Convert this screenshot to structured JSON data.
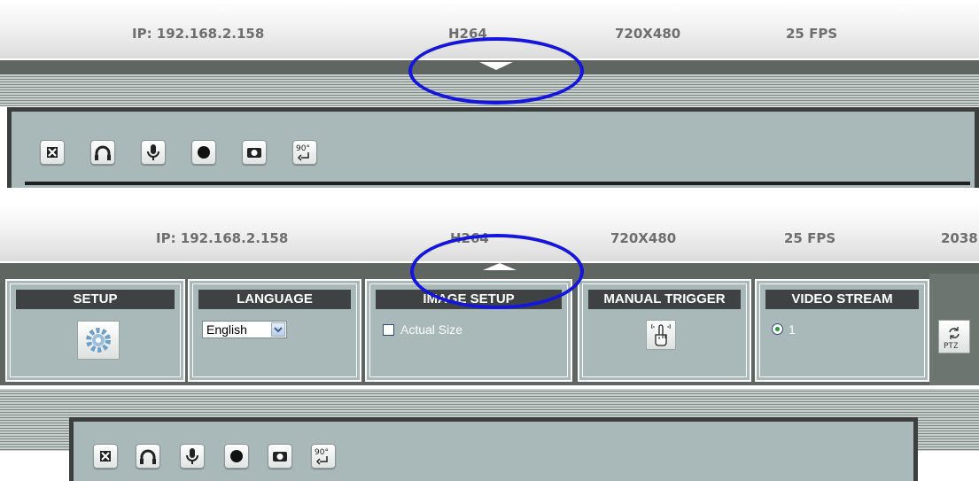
{
  "status_top": {
    "ip": "IP: 192.168.2.158",
    "codec": "H264",
    "resolution": "720X480",
    "fps": "25 FPS"
  },
  "status_bottom": {
    "ip": "IP: 192.168.2.158",
    "codec": "H264",
    "resolution": "720X480",
    "fps": "25 FPS",
    "extra": "2038"
  },
  "toolbar_buttons": [
    {
      "icon": "fullscreen-icon"
    },
    {
      "icon": "headphones-icon"
    },
    {
      "icon": "microphone-icon"
    },
    {
      "icon": "record-icon"
    },
    {
      "icon": "camera-icon"
    },
    {
      "icon": "rotate-90-icon",
      "label": "90°"
    }
  ],
  "menu": {
    "setup": {
      "title": "SETUP",
      "icon": "gear-icon"
    },
    "language": {
      "title": "LANGUAGE",
      "selected": "English",
      "options": [
        "English"
      ]
    },
    "image_setup": {
      "title": "IMAGE SETUP",
      "checkbox_label": "Actual Size",
      "checked": false
    },
    "manual_trigger": {
      "title": "MANUAL TRIGGER",
      "icon": "hand-trigger-icon"
    },
    "video_stream": {
      "title": "VIDEO STREAM",
      "option_label": "1",
      "selected": true
    },
    "ptz": {
      "label": "PTZ",
      "icon": "ptz-icon"
    }
  },
  "colors": {
    "annotation": "#1515e0",
    "panel": "#a9b8b8",
    "dark_bar": "#5f6560",
    "title_bar": "#3f4242"
  }
}
